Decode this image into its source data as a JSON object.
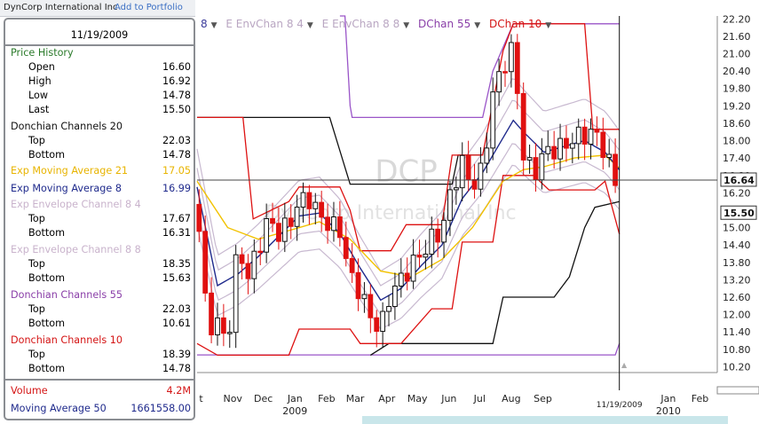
{
  "header": {
    "company": "DynCorp International Inc",
    "add_link": "Add to Portfolio"
  },
  "legend": [
    {
      "label": "8",
      "color": "#3a3a9a"
    },
    {
      "label": "E EnvChan 8 4",
      "color": "#b9a6c2"
    },
    {
      "label": "E EnvChan 8 8",
      "color": "#b9a6c2"
    },
    {
      "label": "DChan 55",
      "color": "#8a3fa8"
    },
    {
      "label": "DChan 10",
      "color": "#d41414"
    }
  ],
  "panel": {
    "date": "11/19/2009",
    "price_history": {
      "title": "Price History",
      "open_label": "Open",
      "open": "16.60",
      "high_label": "High",
      "high": "16.92",
      "low_label": "Low",
      "low": "14.78",
      "last_label": "Last",
      "last": "15.50"
    },
    "dc20": {
      "title": "Donchian Channels 20",
      "top_label": "Top",
      "top": "22.03",
      "bottom_label": "Bottom",
      "bottom": "14.78"
    },
    "ema21": {
      "title": "Exp Moving Average 21",
      "value": "17.05"
    },
    "ema8": {
      "title": "Exp Moving Average 8",
      "value": "16.99"
    },
    "env84": {
      "title": "Exp Envelope Channel 8 4",
      "top_label": "Top",
      "top": "17.67",
      "bottom_label": "Bottom",
      "bottom": "16.31"
    },
    "env88": {
      "title": "Exp Envelope Channel 8 8",
      "top_label": "Top",
      "top": "18.35",
      "bottom_label": "Bottom",
      "bottom": "15.63"
    },
    "dc55": {
      "title": "Donchian Channels 55",
      "top_label": "Top",
      "top": "22.03",
      "bottom_label": "Bottom",
      "bottom": "10.61"
    },
    "dc10": {
      "title": "Donchian Channels 10",
      "top_label": "Top",
      "top": "18.39",
      "bottom_label": "Bottom",
      "bottom": "14.78"
    },
    "volume": {
      "label": "Volume",
      "value": "4.2M"
    },
    "ma50": {
      "label": "Moving Average 50",
      "value": "1661558.00"
    }
  },
  "chart_data": {
    "type": "candlestick",
    "title": "DCP",
    "watermark": "DynCorp International Inc",
    "ylim": [
      10.0,
      22.3
    ],
    "yticks": [
      "22.20",
      "21.60",
      "21.00",
      "20.40",
      "19.80",
      "19.20",
      "18.60",
      "18.00",
      "17.40",
      "16.80",
      "16.20",
      "15.60",
      "15.00",
      "14.40",
      "13.80",
      "13.20",
      "12.60",
      "12.00",
      "11.40",
      "10.80",
      "10.20"
    ],
    "x_labels": [
      {
        "label": "t",
        "day": 4
      },
      {
        "label": "Nov",
        "day": 35
      },
      {
        "label": "Dec",
        "day": 65
      },
      {
        "label": "Jan",
        "day": 96
      },
      {
        "label": "Feb",
        "day": 127
      },
      {
        "label": "Mar",
        "day": 155
      },
      {
        "label": "Apr",
        "day": 186
      },
      {
        "label": "May",
        "day": 216
      },
      {
        "label": "Jun",
        "day": 247
      },
      {
        "label": "Jul",
        "day": 277
      },
      {
        "label": "Aug",
        "day": 308
      },
      {
        "label": "Sep",
        "day": 339
      },
      {
        "label": "Jan",
        "day": 462
      },
      {
        "label": "Feb",
        "day": 493
      }
    ],
    "year_labels": [
      {
        "label": "2009",
        "day": 96
      },
      {
        "label": "2010",
        "day": 462
      }
    ],
    "crosshair_date": "11/19/2009",
    "crosshair_day": 414,
    "crosshair_price": 16.64,
    "badges": [
      {
        "label": "16.64",
        "price": 16.64
      },
      {
        "label": "15.50",
        "price": 15.5
      }
    ],
    "colors": {
      "up": "#111111",
      "down": "#e01010",
      "ema8": "#1f2a8c",
      "ema21": "#f2c200",
      "env": "#c8b9d0",
      "dc55": "#9a55c8",
      "dc20": "#111111",
      "dc10": "#dd1111"
    },
    "closes": [
      {
        "day": 0,
        "close": 15.8
      },
      {
        "day": 10,
        "close": 11.6
      },
      {
        "day": 20,
        "close": 11.7
      },
      {
        "day": 30,
        "close": 11.0
      },
      {
        "day": 40,
        "close": 14.4
      },
      {
        "day": 50,
        "close": 13.3
      },
      {
        "day": 60,
        "close": 14.3
      },
      {
        "day": 70,
        "close": 15.3
      },
      {
        "day": 80,
        "close": 14.8
      },
      {
        "day": 90,
        "close": 15.1
      },
      {
        "day": 100,
        "close": 15.9
      },
      {
        "day": 110,
        "close": 16.0
      },
      {
        "day": 120,
        "close": 15.4
      },
      {
        "day": 130,
        "close": 15.1
      },
      {
        "day": 140,
        "close": 14.9
      },
      {
        "day": 150,
        "close": 13.3
      },
      {
        "day": 160,
        "close": 12.8
      },
      {
        "day": 170,
        "close": 11.9
      },
      {
        "day": 180,
        "close": 11.5
      },
      {
        "day": 190,
        "close": 12.8
      },
      {
        "day": 200,
        "close": 13.2
      },
      {
        "day": 210,
        "close": 13.7
      },
      {
        "day": 220,
        "close": 14.1
      },
      {
        "day": 230,
        "close": 14.6
      },
      {
        "day": 240,
        "close": 14.9
      },
      {
        "day": 250,
        "close": 16.4
      },
      {
        "day": 260,
        "close": 17.2
      },
      {
        "day": 270,
        "close": 16.4
      },
      {
        "day": 280,
        "close": 17.0
      },
      {
        "day": 290,
        "close": 19.6
      },
      {
        "day": 300,
        "close": 20.6
      },
      {
        "day": 310,
        "close": 21.2
      },
      {
        "day": 320,
        "close": 17.5
      },
      {
        "day": 330,
        "close": 16.8
      },
      {
        "day": 340,
        "close": 17.6
      },
      {
        "day": 350,
        "close": 17.7
      },
      {
        "day": 360,
        "close": 17.8
      },
      {
        "day": 370,
        "close": 18.1
      },
      {
        "day": 380,
        "close": 18.2
      },
      {
        "day": 390,
        "close": 18.3
      },
      {
        "day": 400,
        "close": 17.6
      },
      {
        "day": 410,
        "close": 16.6
      },
      {
        "day": 414,
        "close": 15.5
      }
    ],
    "ema8": [
      {
        "day": 0,
        "close": 16.4
      },
      {
        "day": 20,
        "close": 13.0
      },
      {
        "day": 40,
        "close": 13.4
      },
      {
        "day": 60,
        "close": 14.0
      },
      {
        "day": 80,
        "close": 14.7
      },
      {
        "day": 100,
        "close": 15.4
      },
      {
        "day": 120,
        "close": 15.5
      },
      {
        "day": 140,
        "close": 14.8
      },
      {
        "day": 160,
        "close": 13.6
      },
      {
        "day": 180,
        "close": 12.5
      },
      {
        "day": 200,
        "close": 12.9
      },
      {
        "day": 220,
        "close": 13.7
      },
      {
        "day": 240,
        "close": 14.4
      },
      {
        "day": 260,
        "close": 16.0
      },
      {
        "day": 280,
        "close": 16.9
      },
      {
        "day": 300,
        "close": 18.1
      },
      {
        "day": 310,
        "close": 18.7
      },
      {
        "day": 320,
        "close": 18.3
      },
      {
        "day": 340,
        "close": 17.6
      },
      {
        "day": 360,
        "close": 17.8
      },
      {
        "day": 380,
        "close": 18.0
      },
      {
        "day": 400,
        "close": 17.6
      },
      {
        "day": 414,
        "close": 16.99
      }
    ],
    "ema21": [
      {
        "day": 0,
        "close": 16.6
      },
      {
        "day": 30,
        "close": 15.0
      },
      {
        "day": 60,
        "close": 14.6
      },
      {
        "day": 90,
        "close": 14.9
      },
      {
        "day": 120,
        "close": 15.2
      },
      {
        "day": 150,
        "close": 14.6
      },
      {
        "day": 180,
        "close": 13.5
      },
      {
        "day": 210,
        "close": 13.3
      },
      {
        "day": 240,
        "close": 13.9
      },
      {
        "day": 270,
        "close": 15.0
      },
      {
        "day": 300,
        "close": 16.6
      },
      {
        "day": 320,
        "close": 17.0
      },
      {
        "day": 340,
        "close": 17.1
      },
      {
        "day": 370,
        "close": 17.4
      },
      {
        "day": 400,
        "close": 17.5
      },
      {
        "day": 414,
        "close": 17.05
      }
    ],
    "dc10_top": [
      {
        "day": 0,
        "close": 18.8
      },
      {
        "day": 45,
        "close": 18.8
      },
      {
        "day": 55,
        "close": 15.3
      },
      {
        "day": 90,
        "close": 15.9
      },
      {
        "day": 100,
        "close": 16.4
      },
      {
        "day": 140,
        "close": 16.4
      },
      {
        "day": 150,
        "close": 15.6
      },
      {
        "day": 160,
        "close": 14.2
      },
      {
        "day": 190,
        "close": 14.2
      },
      {
        "day": 205,
        "close": 15.1
      },
      {
        "day": 240,
        "close": 15.1
      },
      {
        "day": 250,
        "close": 17.5
      },
      {
        "day": 280,
        "close": 17.5
      },
      {
        "day": 300,
        "close": 21.1
      },
      {
        "day": 310,
        "close": 22.03
      },
      {
        "day": 380,
        "close": 22.03
      },
      {
        "day": 388,
        "close": 18.39
      },
      {
        "day": 414,
        "close": 18.39
      }
    ],
    "dc10_bottom": [
      {
        "day": 0,
        "close": 11.0
      },
      {
        "day": 20,
        "close": 10.6
      },
      {
        "day": 90,
        "close": 10.6
      },
      {
        "day": 100,
        "close": 11.5
      },
      {
        "day": 150,
        "close": 11.5
      },
      {
        "day": 160,
        "close": 11.0
      },
      {
        "day": 200,
        "close": 11.0
      },
      {
        "day": 230,
        "close": 12.2
      },
      {
        "day": 250,
        "close": 12.2
      },
      {
        "day": 260,
        "close": 14.5
      },
      {
        "day": 290,
        "close": 14.5
      },
      {
        "day": 300,
        "close": 16.8
      },
      {
        "day": 330,
        "close": 16.8
      },
      {
        "day": 345,
        "close": 16.3
      },
      {
        "day": 390,
        "close": 16.3
      },
      {
        "day": 400,
        "close": 16.6
      },
      {
        "day": 414,
        "close": 14.78
      }
    ],
    "dc20_top": [
      {
        "day": 0,
        "close": 18.8
      },
      {
        "day": 130,
        "close": 18.8
      },
      {
        "day": 150,
        "close": 16.5
      },
      {
        "day": 250,
        "close": 16.5
      },
      {
        "day": 256,
        "close": 17.5
      },
      {
        "day": 280,
        "close": 17.5
      }
    ],
    "dc20_bottom": [
      {
        "day": 170,
        "close": 10.6
      },
      {
        "day": 188,
        "close": 11.0
      },
      {
        "day": 290,
        "close": 11.0
      },
      {
        "day": 300,
        "close": 12.6
      },
      {
        "day": 350,
        "close": 12.6
      },
      {
        "day": 365,
        "close": 13.3
      },
      {
        "day": 380,
        "close": 15.0
      },
      {
        "day": 390,
        "close": 15.7
      },
      {
        "day": 414,
        "close": 15.9
      }
    ],
    "dc55_top": [
      {
        "day": 140,
        "close": 22.3
      },
      {
        "day": 145,
        "close": 22.3
      },
      {
        "day": 150,
        "close": 19.2
      },
      {
        "day": 152,
        "close": 18.8
      },
      {
        "day": 280,
        "close": 18.8
      },
      {
        "day": 290,
        "close": 20.4
      },
      {
        "day": 310,
        "close": 22.03
      },
      {
        "day": 414,
        "close": 22.03
      }
    ],
    "dc55_bottom": [
      {
        "day": 0,
        "close": 10.61
      },
      {
        "day": 410,
        "close": 10.61
      },
      {
        "day": 414,
        "close": 11.0
      }
    ]
  }
}
